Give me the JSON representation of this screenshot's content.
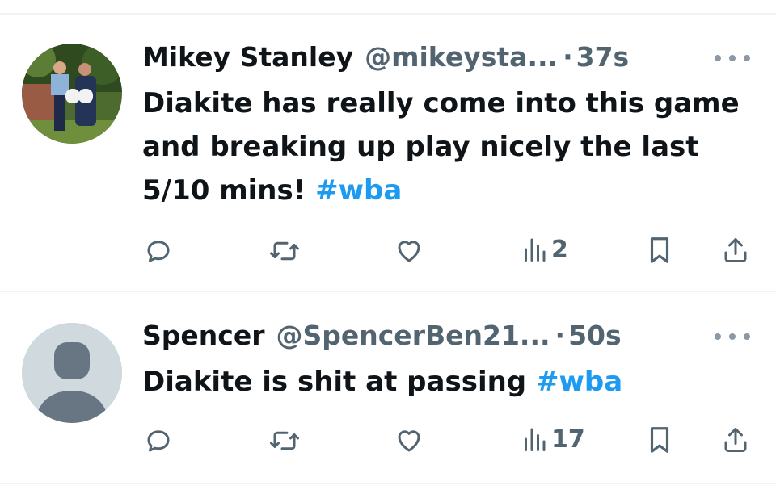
{
  "tweets": [
    {
      "name": "Mikey Stanley",
      "handle": "@mikeysta...",
      "separator": "·",
      "time": "37s",
      "text": "Diakite has really come into this game and breaking up play nicely the last 5/10 mins!",
      "hashtag": "#wba",
      "views": "2",
      "avatar": "profile-photo-family"
    },
    {
      "name": "Spencer",
      "handle": "@SpencerBen21...",
      "separator": "·",
      "time": "50s",
      "text": "Diakite is shit at passing",
      "hashtag": "#wba",
      "views": "17",
      "avatar": "default-profile-silhouette"
    }
  ],
  "colors": {
    "text": "#0f1419",
    "secondary": "#536471",
    "link": "#1d9bf0",
    "divider": "#eff3f4",
    "default_avatar_bg": "#cfd9de",
    "default_avatar_fg": "#687684"
  },
  "icons": [
    "reply-icon",
    "retweet-icon",
    "like-icon",
    "views-icon",
    "bookmark-icon",
    "share-icon",
    "more-icon"
  ]
}
